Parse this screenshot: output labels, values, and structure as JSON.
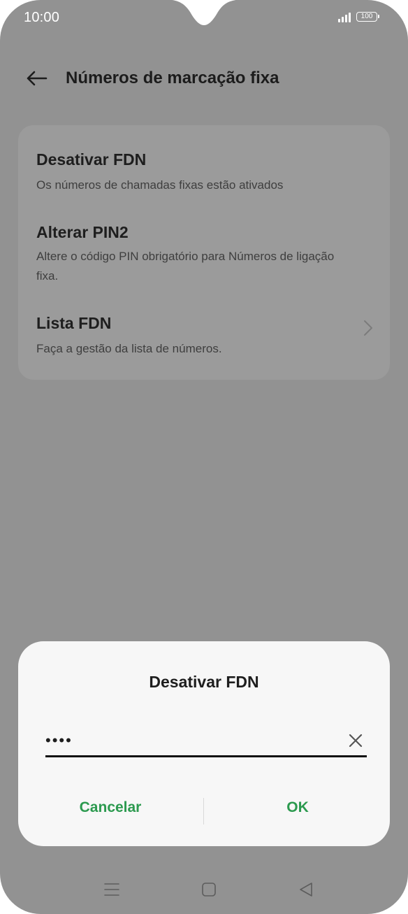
{
  "status_bar": {
    "time": "10:00",
    "battery": "100",
    "icons": [
      "signal-icon",
      "battery-icon"
    ]
  },
  "header": {
    "title": "Números de marcação fixa",
    "back_icon": "arrow-left-icon"
  },
  "settings": {
    "items": [
      {
        "title": "Desativar FDN",
        "subtitle": "Os números de chamadas fixas estão ativados"
      },
      {
        "title": "Alterar PIN2",
        "subtitle": "Altere o código PIN obrigatório para Números de ligação fixa."
      },
      {
        "title": "Lista FDN",
        "subtitle": "Faça a gestão da lista de números.",
        "icon": "chevron-right-icon"
      }
    ]
  },
  "dialog": {
    "title": "Desativar FDN",
    "input_value": "••••",
    "clear_icon": "close-icon",
    "cancel_label": "Cancelar",
    "ok_label": "OK"
  },
  "nav_bar": {
    "icons": [
      "menu-icon",
      "home-icon",
      "back-icon"
    ]
  },
  "colors": {
    "accent": "#2c9a4f",
    "scrim": "#929292",
    "dialog_bg": "#f7f7f7"
  }
}
